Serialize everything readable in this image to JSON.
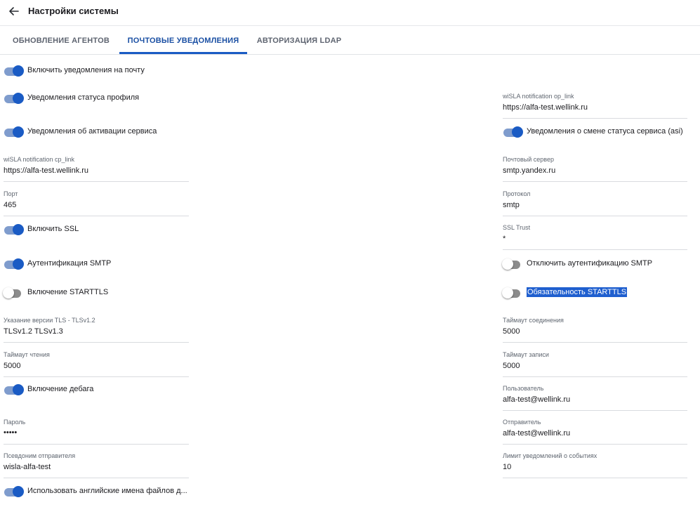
{
  "header": {
    "title": "Настройки системы",
    "back_icon": "arrow-left-icon"
  },
  "tabs": [
    {
      "label": "ОБНОВЛЕНИЕ АГЕНТОВ",
      "active": false
    },
    {
      "label": "ПОЧТОВЫЕ УВЕДОМЛЕНИЯ",
      "active": true
    },
    {
      "label": "АВТОРИЗАЦИЯ LDAP",
      "active": false
    }
  ],
  "colors": {
    "accent": "#1a5bc4",
    "toggle_on_track": "#7f9ccd",
    "toggle_off_track": "#8c8c8c",
    "selection": "#1f5fcf"
  },
  "toggles": {
    "enable_email": {
      "label": "Включить уведомления на почту",
      "on": true
    },
    "profile_status": {
      "label": "Уведомления статуса профиля",
      "on": true
    },
    "service_activation": {
      "label": "Уведомления об активации сервиса",
      "on": true
    },
    "service_status_change": {
      "label": "Уведомления о смене статуса сервиса (asi)",
      "on": true
    },
    "enable_ssl": {
      "label": "Включить SSL",
      "on": true
    },
    "smtp_auth": {
      "label": "Аутентификация SMTP",
      "on": true
    },
    "disable_smtp_auth": {
      "label": "Отключить аутентификацию SMTP",
      "on": false
    },
    "starttls": {
      "label": "Включение STARTTLS",
      "on": false
    },
    "starttls_required": {
      "label": "Обязательность STARTTLS",
      "on": false
    },
    "debug": {
      "label": "Включение дебага",
      "on": true
    },
    "english_filenames": {
      "label": "Использовать английские имена файлов д...",
      "on": true
    }
  },
  "fields": {
    "op_link": {
      "label": "wiSLA notification op_link",
      "value": "https://alfa-test.wellink.ru"
    },
    "cp_link": {
      "label": "wiSLA notification cp_link",
      "value": "https://alfa-test.wellink.ru"
    },
    "mail_server": {
      "label": "Почтовый сервер",
      "value": "smtp.yandex.ru"
    },
    "port": {
      "label": "Порт",
      "value": "465"
    },
    "protocol": {
      "label": "Протокол",
      "value": "smtp"
    },
    "ssl_trust": {
      "label": "SSL Trust",
      "value": "*"
    },
    "tls_version": {
      "label": "Указание версии TLS - TLSv1.2",
      "value": "TLSv1.2 TLSv1.3"
    },
    "connection_timeout": {
      "label": "Таймаут соединения",
      "value": "5000"
    },
    "read_timeout": {
      "label": "Таймаут чтения",
      "value": "5000"
    },
    "write_timeout": {
      "label": "Таймаут записи",
      "value": "5000"
    },
    "user": {
      "label": "Пользователь",
      "value": "alfa-test@wellink.ru"
    },
    "password": {
      "label": "Пароль",
      "value": "•••••"
    },
    "sender": {
      "label": "Отправитель",
      "value": "alfa-test@wellink.ru"
    },
    "sender_alias": {
      "label": "Псевдоним отправителя",
      "value": "wisla-alfa-test"
    },
    "event_limit": {
      "label": "Лимит уведомлений о событиях",
      "value": "10"
    }
  }
}
